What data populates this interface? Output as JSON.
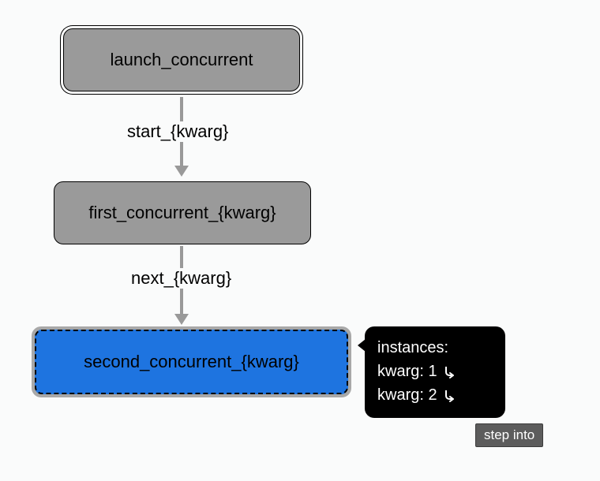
{
  "nodes": {
    "root": "launch_concurrent",
    "first": "first_concurrent_{kwarg}",
    "second": "second_concurrent_{kwarg}"
  },
  "edges": {
    "start": "start_{kwarg}",
    "next": "next_{kwarg}"
  },
  "tooltip": {
    "title": "instances:",
    "rows": [
      "kwarg: 1",
      "kwarg: 2"
    ]
  },
  "step_into_label": "step into"
}
